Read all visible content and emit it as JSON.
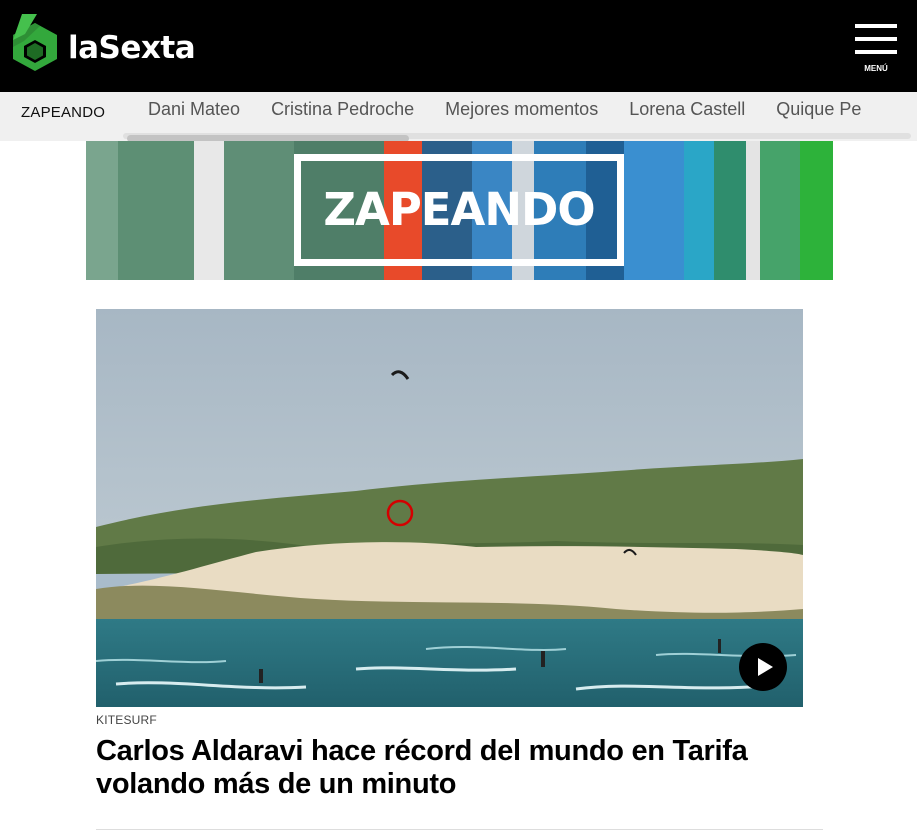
{
  "header": {
    "logo_text": "laSexta",
    "menu_label": "MENÚ",
    "colors": {
      "background": "#000000",
      "logo_green": "#33a83c"
    }
  },
  "subnav": {
    "section": "ZAPEANDO",
    "tags": [
      {
        "label": "Dani Mateo"
      },
      {
        "label": "Cristina Pedroche"
      },
      {
        "label": "Mejores momentos"
      },
      {
        "label": "Lorena Castell"
      },
      {
        "label": "Quique Pe"
      }
    ]
  },
  "banner": {
    "title": "ZAPEANDO"
  },
  "article": {
    "kicker": "KITESURF",
    "headline": "Carlos Aldaravi hace récord del mundo en Tarifa volando más de un minuto",
    "media": {
      "type": "video",
      "play_icon": "play-icon"
    }
  }
}
